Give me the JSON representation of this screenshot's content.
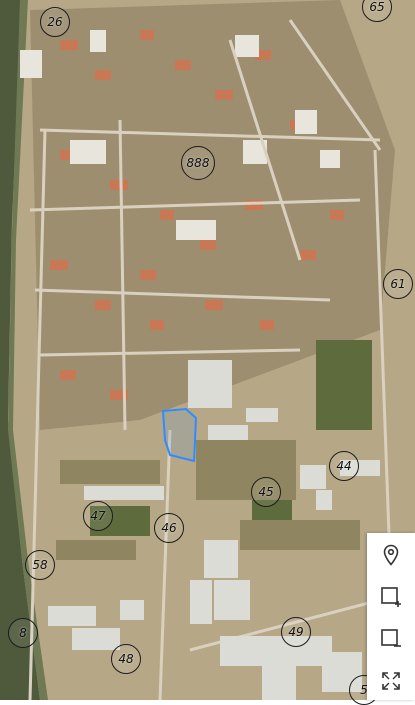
{
  "map": {
    "labels": [
      {
        "id": "26",
        "text": "26"
      },
      {
        "id": "65",
        "text": "65"
      },
      {
        "id": "888",
        "text": "888"
      },
      {
        "id": "61",
        "text": "61"
      },
      {
        "id": "44",
        "text": "44"
      },
      {
        "id": "45",
        "text": "45"
      },
      {
        "id": "47",
        "text": "47"
      },
      {
        "id": "46",
        "text": "46"
      },
      {
        "id": "58",
        "text": "58"
      },
      {
        "id": "8",
        "text": "8"
      },
      {
        "id": "49",
        "text": "49"
      },
      {
        "id": "48",
        "text": "48"
      },
      {
        "id": "5",
        "text": "5"
      }
    ]
  },
  "toolbar": {
    "tools": [
      {
        "name": "location-pin-icon"
      },
      {
        "name": "add-area-icon"
      },
      {
        "name": "remove-area-icon"
      },
      {
        "name": "fullscreen-icon"
      }
    ]
  },
  "colors": {
    "selection": "#2f8cff",
    "aerial_base": "#b9ab8a"
  }
}
